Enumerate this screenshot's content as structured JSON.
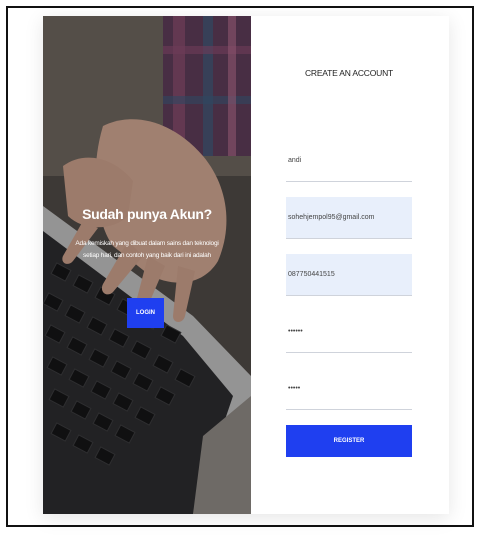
{
  "promo": {
    "title": "Sudah punya Akun?",
    "text": "Ada kemiskah yang dibuat dalam sains dan teknologi setiap hari, dan contoh yang baik dari ini adalah",
    "login_label": "LOGIN"
  },
  "form": {
    "title": "CREATE AN ACCOUNT",
    "fields": [
      {
        "value": "andi"
      },
      {
        "value": "sohehjempol95@gmail.com"
      },
      {
        "value": "087750441515"
      },
      {
        "value": "••••••"
      },
      {
        "value": "•••••"
      }
    ],
    "register_label": "REGISTER"
  },
  "colors": {
    "primary_button": "#1f3ff0",
    "autofill_background": "#e8effb"
  }
}
